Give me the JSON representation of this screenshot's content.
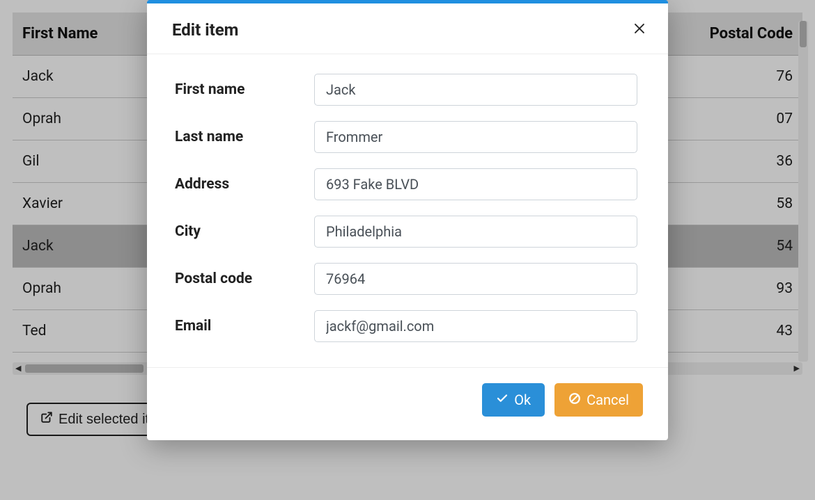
{
  "table": {
    "headers": {
      "first_name": "First Name",
      "postal_code": "Postal Code"
    },
    "rows": [
      {
        "first_name": "Jack",
        "postal_tail": "76"
      },
      {
        "first_name": "Oprah",
        "postal_tail": "07"
      },
      {
        "first_name": "Gil",
        "postal_tail": "36"
      },
      {
        "first_name": "Xavier",
        "postal_tail": "58"
      },
      {
        "first_name": "Jack",
        "postal_tail": "54",
        "selected": true
      },
      {
        "first_name": "Oprah",
        "postal_tail": "93"
      },
      {
        "first_name": "Ted",
        "postal_tail": "43"
      }
    ],
    "edit_button": "Edit selected item"
  },
  "modal": {
    "title": "Edit item",
    "labels": {
      "first_name": "First name",
      "last_name": "Last name",
      "address": "Address",
      "city": "City",
      "postal_code": "Postal code",
      "email": "Email"
    },
    "values": {
      "first_name": "Jack",
      "last_name": "Frommer",
      "address": "693 Fake BLVD",
      "city": "Philadelphia",
      "postal_code": "76964",
      "email": "jackf@gmail.com"
    },
    "buttons": {
      "ok": "Ok",
      "cancel": "Cancel"
    }
  }
}
